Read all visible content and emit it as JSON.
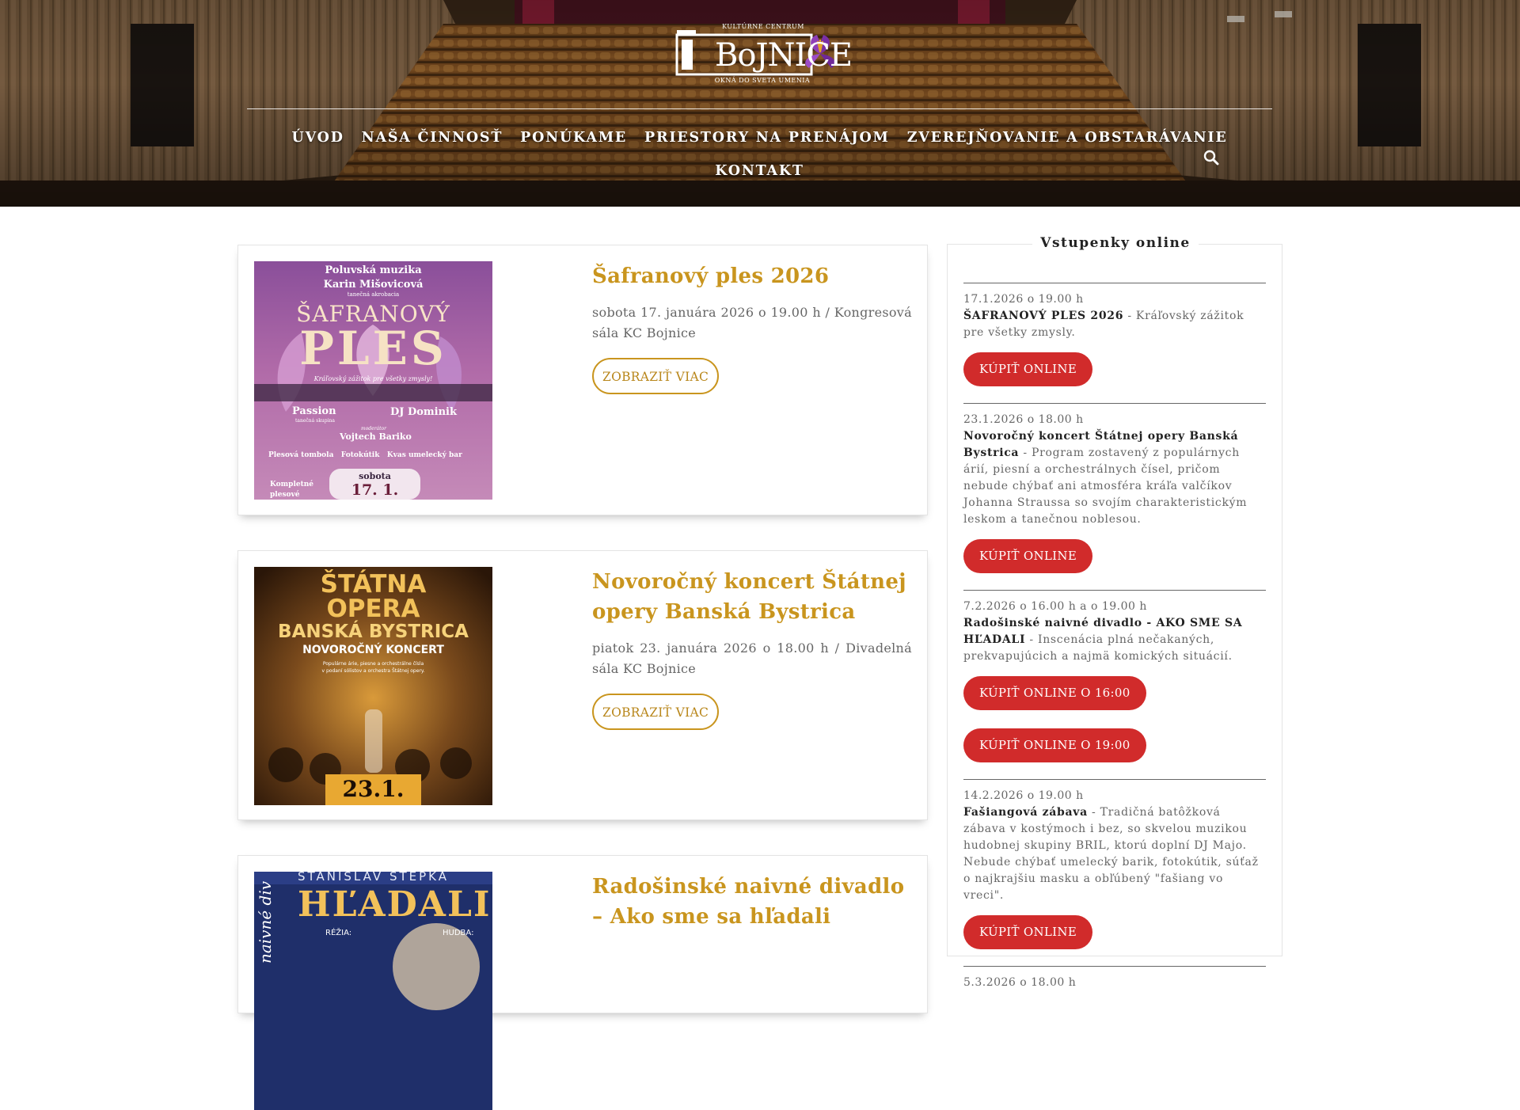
{
  "logo": {
    "top_text": "KULTÚRNE CENTRUM",
    "word": "BoJNICE",
    "bottom_text": "OKNÁ DO SVETA UMENIA",
    "accent_color": "#8e3fb7"
  },
  "nav": {
    "row1": [
      "ÚVOD",
      "NAŠA ČINNOSŤ",
      "PONÚKAME",
      "PRIESTORY NA PRENÁJOM",
      "ZVEREJŇOVANIE A OBSTARÁVANIE"
    ],
    "row2": [
      "KONTAKT"
    ],
    "search_icon": "search-icon"
  },
  "events": [
    {
      "title": "Šafranový ples 2026",
      "meta": "sobota 17. januára 2026 o 19.00 h / Kongresová sála KC Bojnice",
      "button": "ZOBRAZIŤ VIAC",
      "poster": {
        "lines": [
          "Poluvská muzika",
          "Karin Mišovicová",
          "tanečná akrobacia"
        ],
        "headline1": "ŠAFRANOVÝ",
        "headline2": "PLES",
        "tagline": "Kráľovský zážitok pre všetky zmysly!",
        "acts_left": "Passion",
        "acts_left_sub": "tanečná skupina",
        "acts_right": "DJ Dominik",
        "moderator_label": "moderátor",
        "moderator": "Vojtech Bariko",
        "extras": "Plesová tombola   Fotokútik   Kvas umelecký bar",
        "corner": "Kompletné plesové",
        "day": "sobota",
        "date": "17. 1."
      }
    },
    {
      "title": "Novoročný koncert Štátnej opery Banská Bystrica",
      "meta": "piatok 23. januára 2026 o 18.00 h / Divadelná sála KC Bojnice",
      "button": "ZOBRAZIŤ VIAC",
      "poster": {
        "line1": "ŠTÁTNA",
        "line2": "OPERA",
        "line3": "BANSKÁ BYSTRICA",
        "line4": "NOVOROČNÝ KONCERT",
        "small1": "Populárne árie, piesne a orchestrálne čísla",
        "small2": "v podaní sólistov a orchestra Štátnej opery.",
        "date": "23.1."
      }
    },
    {
      "title": "Radošinské naivné divadlo – Ako sme sa hľadali",
      "meta": "",
      "button": "",
      "poster": {
        "author": "STANISLAV ŠTEPKA",
        "headline": "HĽADALI",
        "side": "naivné div",
        "credit_left": "RÉŽIA:",
        "credit_right": "HUDBA:"
      }
    }
  ],
  "sidebar": {
    "title": "Vstupenky online",
    "tickets": [
      {
        "date": "17.1.2026 o 19.00 h",
        "name": "ŠAFRANOVÝ PLES 2026",
        "desc": " - Kráľovský zážitok pre všetky zmysly.",
        "buttons": [
          "KÚPIŤ ONLINE"
        ]
      },
      {
        "date": "23.1.2026 o 18.00 h",
        "name": "Novoročný koncert Štátnej opery Banská Bystrica",
        "desc": " - Program zostavený z populárnych árií, piesní a orchestrálnych čísel, pričom nebude chýbať ani atmosféra kráľa valčíkov Johanna Straussa so svojím charakteristickým leskom a tanečnou noblesou.",
        "buttons": [
          "KÚPIŤ ONLINE"
        ]
      },
      {
        "date": "7.2.2026 o 16.00 h a o 19.00 h",
        "name": "Radošinské naivné divadlo - AKO SME SA HĽADALI",
        "desc": " - Inscenácia plná nečakaných, prekvapujúcich a najmä komických situácií.",
        "buttons": [
          "KÚPIŤ ONLINE O 16:00",
          "KÚPIŤ ONLINE O 19:00"
        ]
      },
      {
        "date": "14.2.2026 o 19.00 h",
        "name": "Fašiangová zábava",
        "desc": " - Tradičná batôžková zábava v kostýmoch i bez, so skvelou muzikou hudobnej skupiny BRIL, ktorú doplní DJ Majo. Nebude chýbať umelecký barik, fotokútik, súťaž o najkrajšiu masku a obľúbený \"fašiang vo vreci\".",
        "buttons": [
          "KÚPIŤ ONLINE"
        ]
      },
      {
        "date": "5.3.2026 o 18.00 h",
        "name": "",
        "desc": "",
        "buttons": []
      }
    ]
  },
  "colors": {
    "gold": "#c9951e",
    "buy_red": "#d12b2b",
    "purple": "#8e3fb7"
  }
}
